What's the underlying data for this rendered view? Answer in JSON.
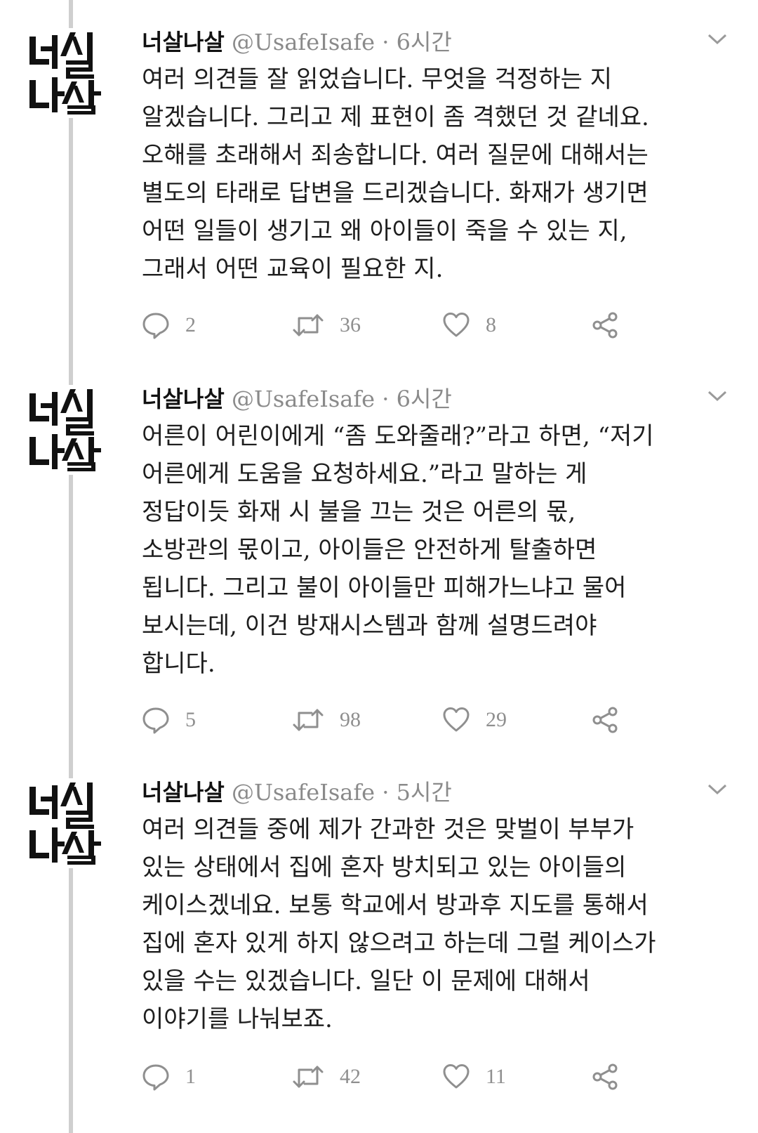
{
  "tweets": [
    {
      "name": "너살나살",
      "handle": "@UsafeIsafe",
      "separator": "·",
      "time": "6시간",
      "lines": [
        "여러 의견들 잘 읽었습니다. 무엇을 걱정하는 지",
        "알겠습니다. 그리고 제 표현이 좀 격했던 것 같네요.",
        "오해를 초래해서 죄송합니다. 여러 질문에 대해서는",
        "별도의 타래로 답변을 드리겠습니다. 화재가 생기면",
        "어떤 일들이 생기고 왜 아이들이 죽을 수 있는 지,",
        "그래서 어떤 교육이 필요한 지."
      ],
      "replies": "2",
      "retweets": "36",
      "likes": "8"
    },
    {
      "name": "너살나살",
      "handle": "@UsafeIsafe",
      "separator": "·",
      "time": "6시간",
      "lines": [
        "어른이 어린이에게 “좀 도와줄래?”라고 하면, “저기",
        "어른에게 도움을 요청하세요.”라고 말하는 게",
        "정답이듯 화재 시 불을 끄는 것은 어른의 몫,",
        "소방관의 몫이고, 아이들은 안전하게 탈출하면",
        "됩니다. 그리고 불이 아이들만 피해가느냐고 물어",
        "보시는데, 이건 방재시스템과 함께 설명드려야",
        "합니다."
      ],
      "replies": "5",
      "retweets": "98",
      "likes": "29"
    },
    {
      "name": "너살나살",
      "handle": "@UsafeIsafe",
      "separator": "·",
      "time": "5시간",
      "lines": [
        "여러 의견들 중에 제가 간과한 것은 맞벌이 부부가",
        "있는 상태에서 집에 혼자 방치되고 있는 아이들의",
        "케이스겠네요. 보통 학교에서 방과후 지도를 통해서",
        "집에 혼자 있게 하지 않으려고 하는데 그럴 케이스가",
        "있을 수는 있겠습니다. 일단 이 문제에 대해서",
        "이야기를 나눠보죠."
      ],
      "replies": "1",
      "retweets": "42",
      "likes": "11"
    }
  ],
  "avatar": {
    "logo_text": "너살나살",
    "name": "avatar-logo"
  },
  "icons": {
    "reply": "reply-icon",
    "retweet": "retweet-icon",
    "like": "heart-icon",
    "share": "share-icon",
    "menu": "chevron-down-icon"
  },
  "colors": {
    "icon": "#8f8f8f",
    "text": "#1e1e1e",
    "meta": "#8a8a8a",
    "thread_line": "#cfcfcf"
  }
}
